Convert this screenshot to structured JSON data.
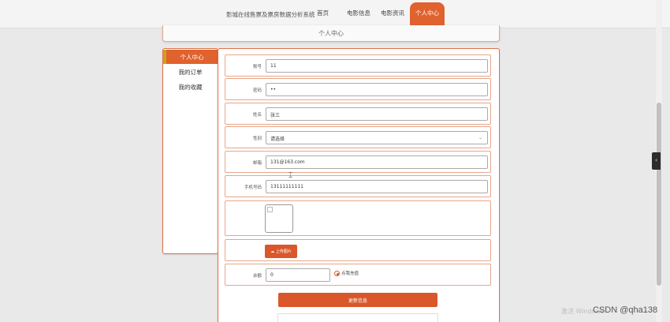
{
  "nav": {
    "site_title": "影城在线售票及票房数据分析系统",
    "items": [
      "首页",
      "电影信息",
      "电影资讯"
    ],
    "active": "个人中心"
  },
  "page_header": "个人中心",
  "sidebar": {
    "active": "个人中心",
    "items": [
      "我的订单",
      "我的收藏"
    ]
  },
  "form": {
    "account": {
      "label": "账号",
      "value": "11"
    },
    "password": {
      "label": "密码",
      "value": "••"
    },
    "name": {
      "label": "姓名",
      "value": "张三"
    },
    "gender": {
      "label": "性别",
      "value": "请选择"
    },
    "email": {
      "label": "邮箱",
      "value": "131@163.com"
    },
    "phone": {
      "label": "手机号码",
      "value": "13111111111"
    },
    "upload_label": "上传图片",
    "balance": {
      "label": "余额",
      "value": "0",
      "recharge": "点我充值"
    },
    "submit": "更新信息"
  },
  "overlay": {
    "windows_watermark": "激活 Windows",
    "csdn_watermark": "CSDN @qha138"
  },
  "icons": {
    "upload": "upload-icon",
    "select": "chevron-down-icon",
    "side_tab": "chevron-left-icon"
  },
  "colors": {
    "accent": "#e0622e",
    "accent_border": "#d4a017",
    "button": "#d9572a"
  }
}
